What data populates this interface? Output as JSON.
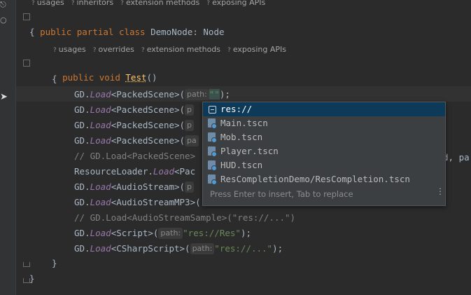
{
  "codelens_top": [
    "usages",
    "inheritors",
    "extension methods",
    "exposing APIs"
  ],
  "codelens_method": [
    "usages",
    "overrides",
    "extension methods",
    "exposing APIs"
  ],
  "code": {
    "class_decl": {
      "kw": "public partial class",
      "name": "DemoNode",
      "sep": ": ",
      "base": "Node"
    },
    "open_brace": "{",
    "method_decl": {
      "kw": "public void",
      "name": "Test",
      "parens": "()"
    },
    "method_open": "{",
    "lines": [
      {
        "obj": "GD.",
        "call": "Load",
        "rest": "<PackedScene>(",
        "hint": "path:",
        "str": "\"\"",
        "tail": ");"
      },
      {
        "obj": "GD.",
        "call": "Load",
        "rest": "<PackedScene>(",
        "hint": "p"
      },
      {
        "obj": "GD.",
        "call": "Load",
        "rest": "<PackedScene>(",
        "hint": "p"
      },
      {
        "obj": "GD.",
        "call": "Load",
        "rest": "<PackedScene>(",
        "hint": "pa"
      },
      {
        "comment": "// GD.Load<PackedScene>"
      },
      {
        "obj": "ResourceLoader.",
        "call": "Load",
        "rest": "<Pac"
      },
      {
        "obj": "GD.",
        "call": "Load",
        "rest": "<AudioStream>(",
        "hint": "p"
      },
      {
        "obj": "GD.",
        "call": "Load",
        "rest": "<AudioStreamMP3>("
      },
      {
        "comment": "// GD.Load<AudioStreamSample>(\"res://...\")"
      },
      {
        "obj": "GD.",
        "call": "Load",
        "rest": "<Script>(",
        "hint": "path:",
        "str": "\"res://Res\"",
        "tail": ");"
      },
      {
        "obj": "GD.",
        "call": "Load",
        "rest": "<CSharpScript>(",
        "hint": "path:",
        "str": "\"res://...\"",
        "tail": ");"
      }
    ],
    "method_close": "}",
    "class_close": "}",
    "clipped_right": "d, pa"
  },
  "completion": {
    "items": [
      {
        "label": "res://",
        "icon": "resource-folder-icon",
        "selected": true
      },
      {
        "label": "Main.tscn",
        "icon": "scene-file-icon",
        "selected": false
      },
      {
        "label": "Mob.tscn",
        "icon": "scene-file-icon",
        "selected": false
      },
      {
        "label": "Player.tscn",
        "icon": "scene-file-icon",
        "selected": false
      },
      {
        "label": "HUD.tscn",
        "icon": "scene-file-icon",
        "selected": false
      },
      {
        "label": "ResCompletionDemo/ResCompletion.tscn",
        "icon": "scene-file-icon",
        "selected": false
      }
    ],
    "footer": "Press Enter to insert, Tab to replace",
    "menu_glyph": "⋮"
  },
  "colors": {
    "background": "#2b2b2b",
    "keyword": "#cc7832",
    "method": "#ffc66d",
    "call": "#9876aa",
    "string": "#6a8759",
    "comment": "#808080",
    "selection": "#0d3a58"
  }
}
